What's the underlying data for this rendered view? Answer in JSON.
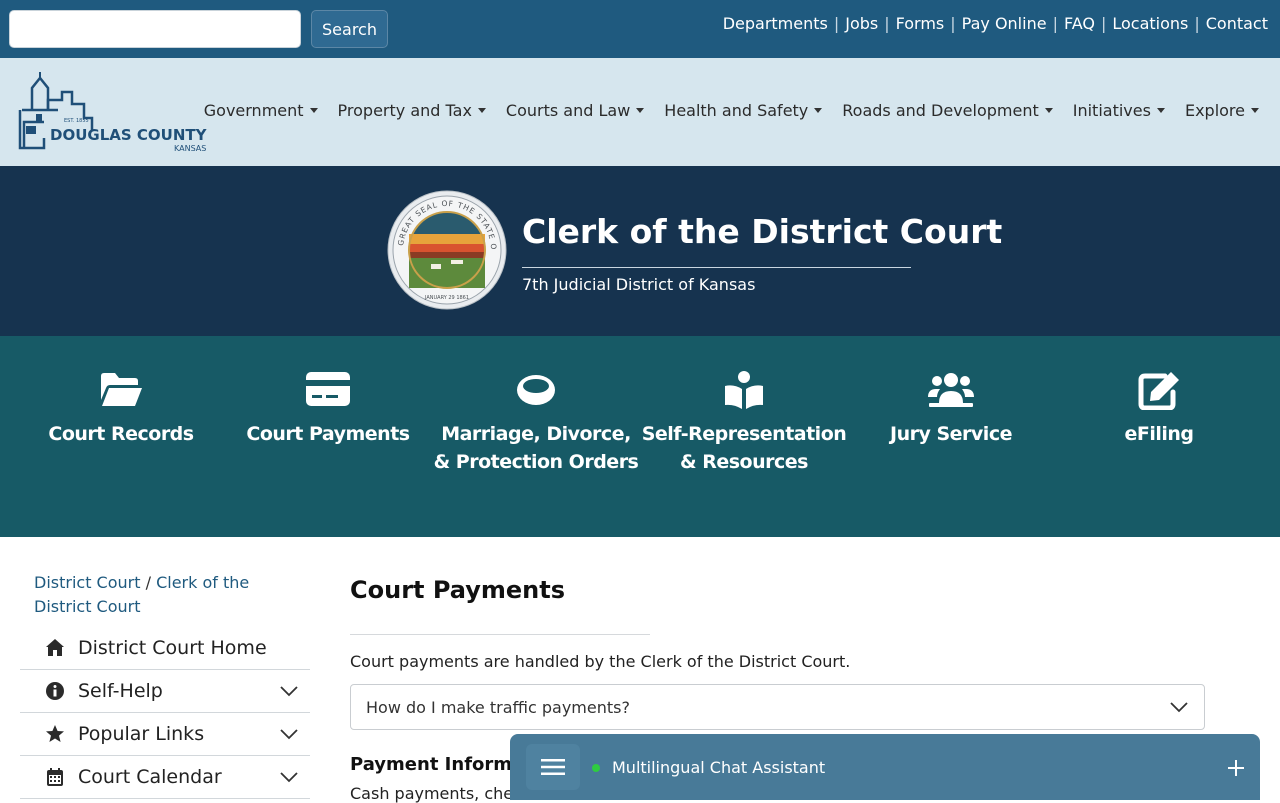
{
  "topbar": {
    "search": {
      "value": "",
      "placeholder": "",
      "button_label": "Search"
    },
    "links": [
      "Departments",
      "Jobs",
      "Forms",
      "Pay Online",
      "FAQ",
      "Locations",
      "Contact"
    ],
    "separator": "|"
  },
  "logo": {
    "name": "DOUGLAS COUNTY",
    "state": "KANSAS",
    "est": "EST. 1855"
  },
  "nav": {
    "items": [
      "Government",
      "Property and Tax",
      "Courts and Law",
      "Health and Safety",
      "Roads and Development",
      "Initiatives",
      "Explore"
    ]
  },
  "hero": {
    "title": "Clerk of the District Court",
    "subtitle": "7th Judicial District of Kansas",
    "seal_text": "GREAT SEAL OF THE STATE OF KANSAS",
    "seal_date": "JANUARY 29 1861"
  },
  "quick_links": [
    {
      "label": "Court Records",
      "icon": "folder-open-icon"
    },
    {
      "label": "Court Payments",
      "icon": "credit-card-icon"
    },
    {
      "label": "Marriage, Divorce, & Protection Orders",
      "icon": "ring-icon"
    },
    {
      "label": "Self-Representation & Resources",
      "icon": "reader-icon"
    },
    {
      "label": "Jury Service",
      "icon": "users-icon"
    },
    {
      "label": "eFiling",
      "icon": "edit-icon"
    }
  ],
  "breadcrumb": {
    "items": [
      "District Court",
      "Clerk of the District Court"
    ],
    "separator": "/"
  },
  "sidebar": {
    "items": [
      {
        "label": "District Court Home",
        "icon": "home-icon",
        "expandable": false
      },
      {
        "label": "Self-Help",
        "icon": "info-circle-icon",
        "expandable": true
      },
      {
        "label": "Popular Links",
        "icon": "star-icon",
        "expandable": true
      },
      {
        "label": "Court Calendar",
        "icon": "calendar-icon",
        "expandable": true
      }
    ]
  },
  "main": {
    "title": "Court Payments",
    "intro": "Court payments are handled by the Clerk of the District Court.",
    "accordion_label": "How do I make traffic payments?",
    "sub_heading": "Payment Informatio",
    "body_text": "Cash payments, chec"
  },
  "chat": {
    "label": "Multilingual Chat Assistant",
    "status_color": "#2ecc40"
  },
  "colors": {
    "topbar": "#1f5a7f",
    "nav": "#d6e6ee",
    "hero": "#16334f",
    "quick": "#175a66",
    "link": "#1f5a7f",
    "chat": "#487a98"
  }
}
